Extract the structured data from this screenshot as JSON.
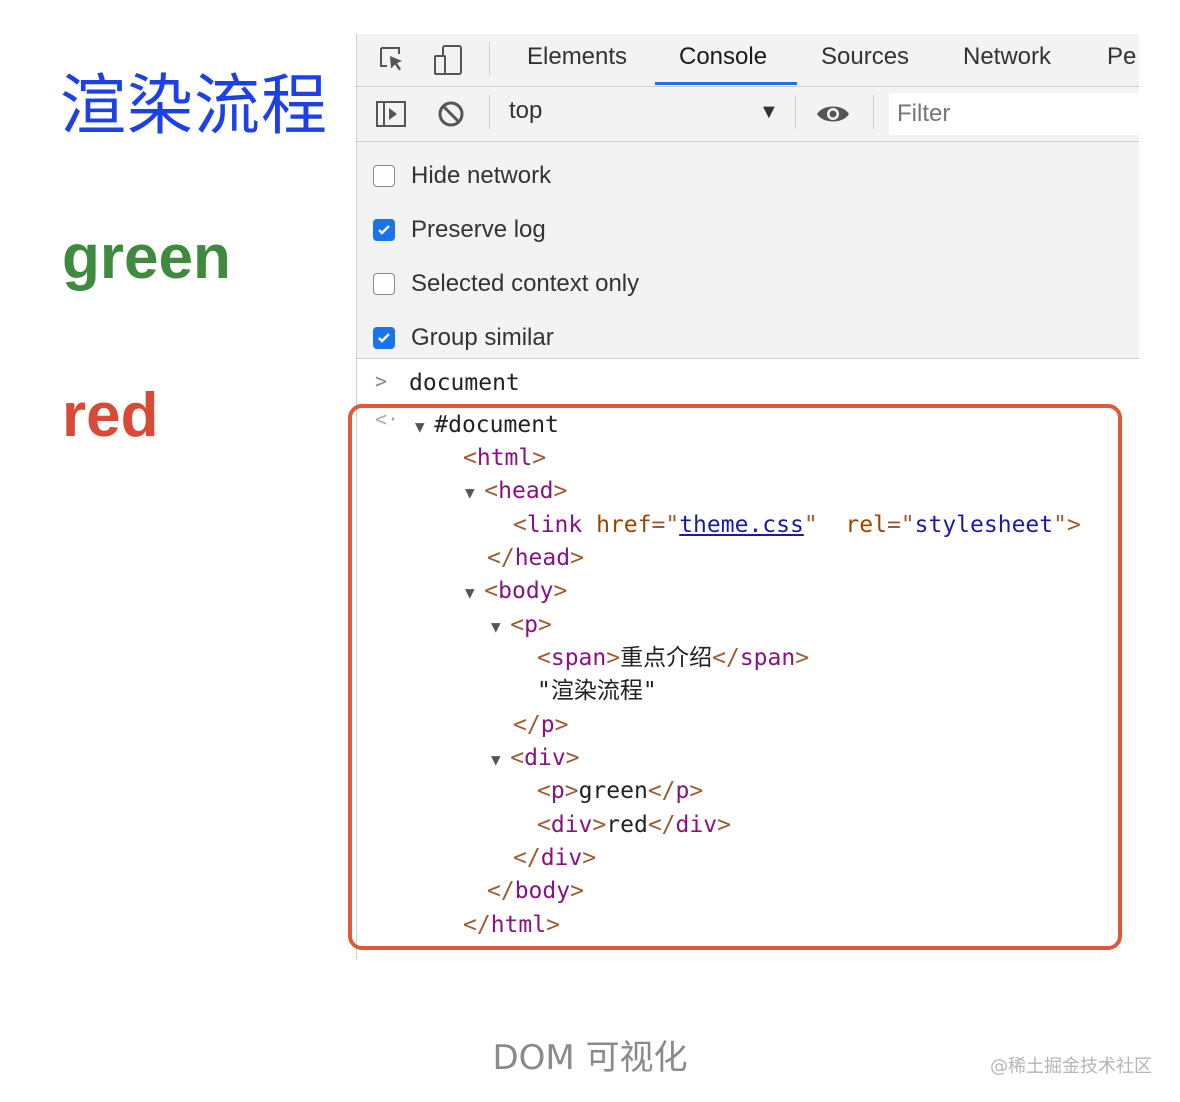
{
  "page": {
    "heading": "渲染流程",
    "green_text": "green",
    "red_text": "red",
    "colors": {
      "heading": "#1e41e6",
      "green": "#3f8a3f",
      "red": "#d94a36"
    }
  },
  "devtools": {
    "tabs": [
      "Elements",
      "Console",
      "Sources",
      "Network",
      "Pe"
    ],
    "active_tab": "Console",
    "context_value": "top",
    "filter_placeholder": "Filter",
    "icons": {
      "inspect": "inspect-element-icon",
      "device": "device-toolbar-icon",
      "sidebar": "console-sidebar-icon",
      "clear": "clear-console-icon",
      "eye": "live-expression-eye-icon"
    },
    "settings": [
      {
        "label": "Hide network",
        "checked": false
      },
      {
        "label": "Preserve log",
        "checked": true
      },
      {
        "label": "Selected context only",
        "checked": false
      },
      {
        "label": "Group similar",
        "checked": true
      }
    ],
    "console": {
      "command": "document",
      "tree": {
        "document": "#document",
        "html": "html",
        "head": "head",
        "link": "link",
        "href_attr": "href",
        "href_val": "theme.css",
        "rel_attr": "rel",
        "rel_val": "stylesheet",
        "body": "body",
        "p": "p",
        "span": "span",
        "span_text": "重点介绍",
        "text_node": "\"渲染流程\"",
        "div": "div",
        "green_text": "green",
        "red_text": "red"
      }
    },
    "accent_color": "#1a73e8",
    "highlight_color": "#e0573a"
  },
  "caption": "DOM 可视化",
  "watermark": "@稀土掘金技术社区"
}
